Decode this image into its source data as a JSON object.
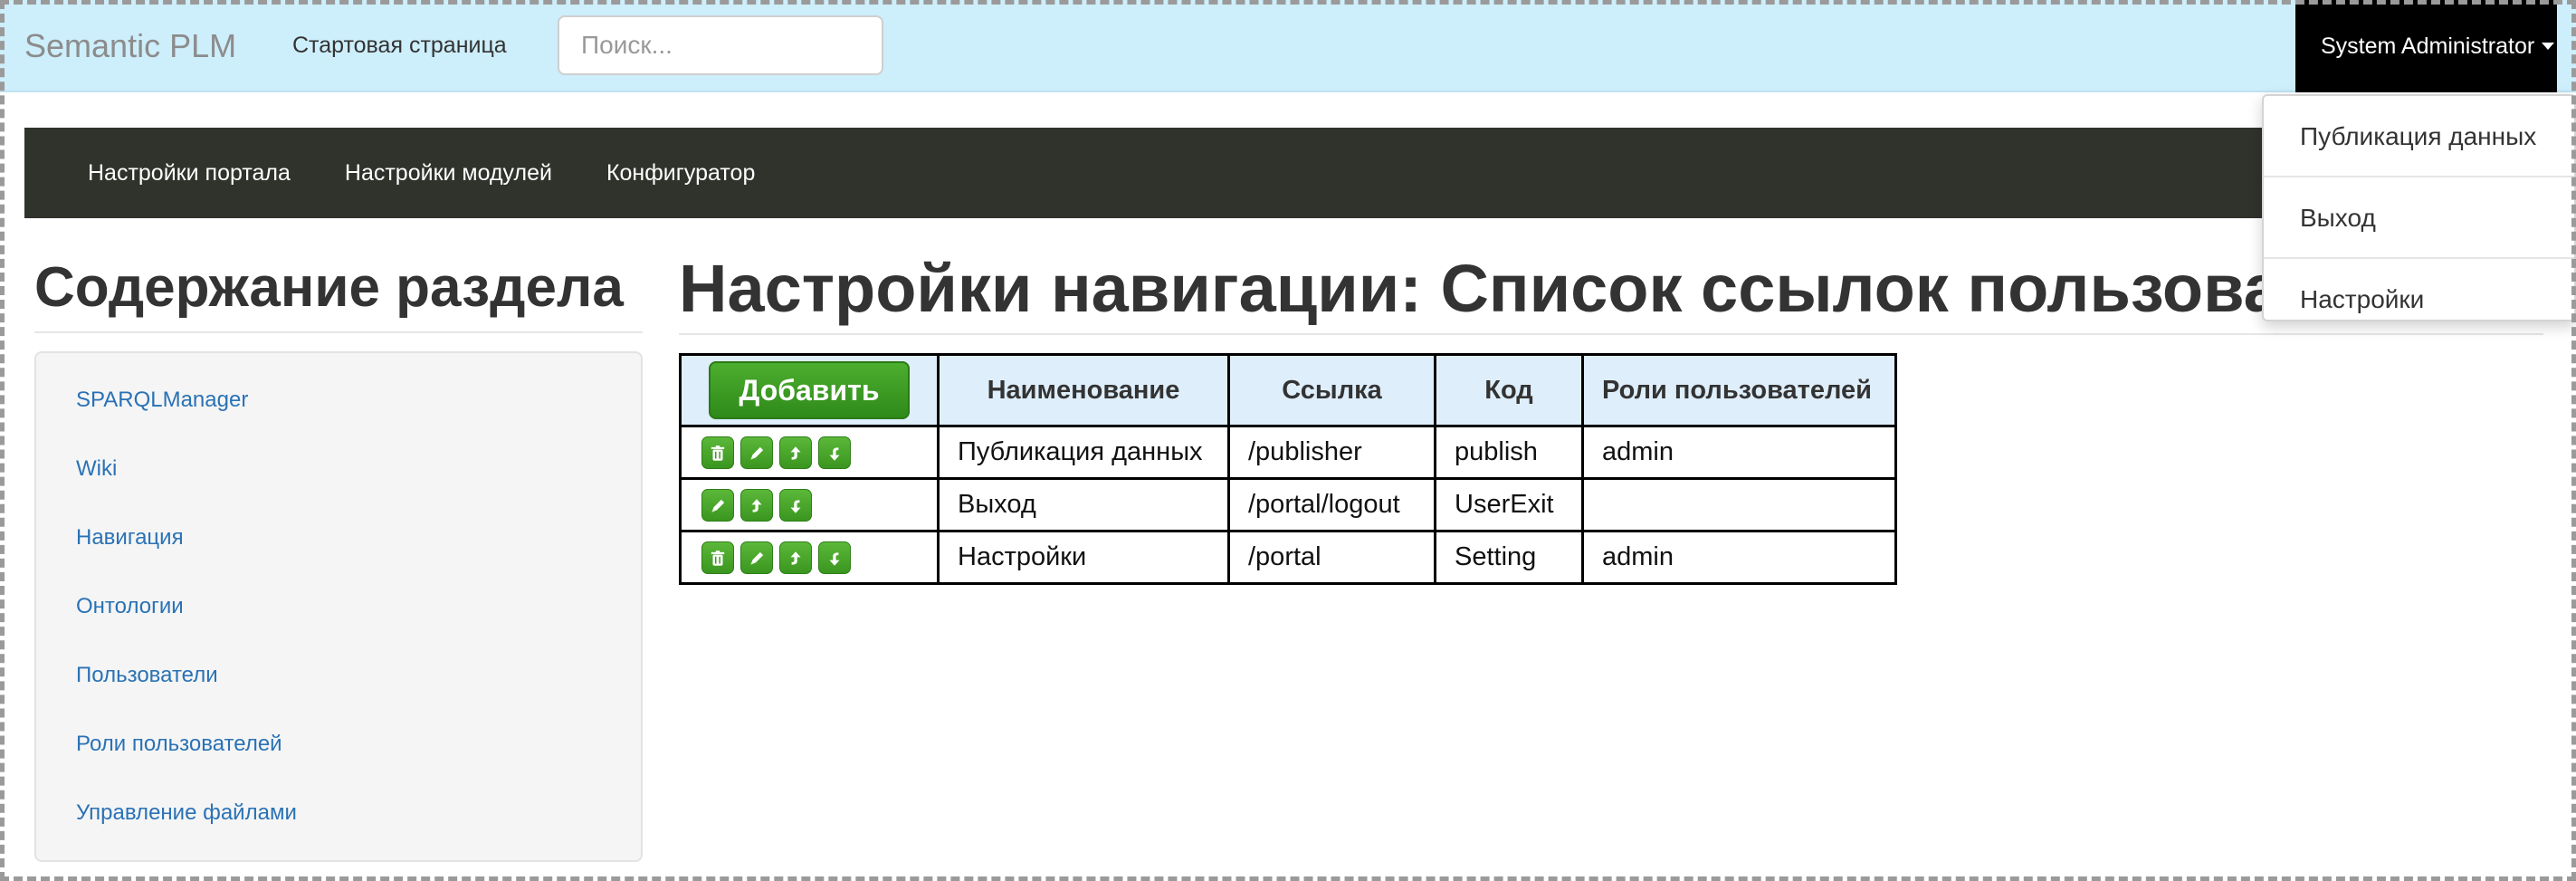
{
  "topbar": {
    "brand": "Semantic PLM",
    "home_link": "Стартовая страница",
    "search_placeholder": "Поиск...",
    "user_label": "System Administrator"
  },
  "user_menu": {
    "items": [
      {
        "label": "Публикация данных"
      },
      {
        "label": "Выход"
      },
      {
        "label": "Настройки"
      }
    ]
  },
  "subnav": {
    "items": [
      {
        "label": "Настройки портала"
      },
      {
        "label": "Настройки модулей"
      },
      {
        "label": "Конфигуратор"
      }
    ]
  },
  "sidebar": {
    "title": "Содержание раздела",
    "items": [
      {
        "label": "SPARQLManager"
      },
      {
        "label": "Wiki"
      },
      {
        "label": "Навигация"
      },
      {
        "label": "Онтологии"
      },
      {
        "label": "Пользователи"
      },
      {
        "label": "Роли пользователей"
      },
      {
        "label": "Управление файлами"
      }
    ]
  },
  "main": {
    "title": "Настройки навигации: Список ссылок пользоват",
    "add_button": "Добавить",
    "columns": [
      "Наименование",
      "Ссылка",
      "Код",
      "Роли пользователей"
    ],
    "rows": [
      {
        "name": "Публикация данных",
        "link": "/publisher",
        "code": "publish",
        "roles": "admin",
        "actions": [
          "trash-icon",
          "edit-icon",
          "move-up-icon",
          "move-down-icon"
        ]
      },
      {
        "name": "Выход",
        "link": "/portal/logout",
        "code": "UserExit",
        "roles": "",
        "actions": [
          "edit-icon",
          "move-up-icon",
          "move-down-icon"
        ]
      },
      {
        "name": "Настройки",
        "link": "/portal",
        "code": "Setting",
        "roles": "admin",
        "actions": [
          "trash-icon",
          "edit-icon",
          "move-up-icon",
          "move-down-icon"
        ]
      }
    ]
  },
  "colors": {
    "topbar_bg": "#cdeefb",
    "subnav_bg": "#2f332b",
    "link": "#2a72b5",
    "button_green": "#3a961f",
    "table_header_bg": "#deeefb"
  }
}
